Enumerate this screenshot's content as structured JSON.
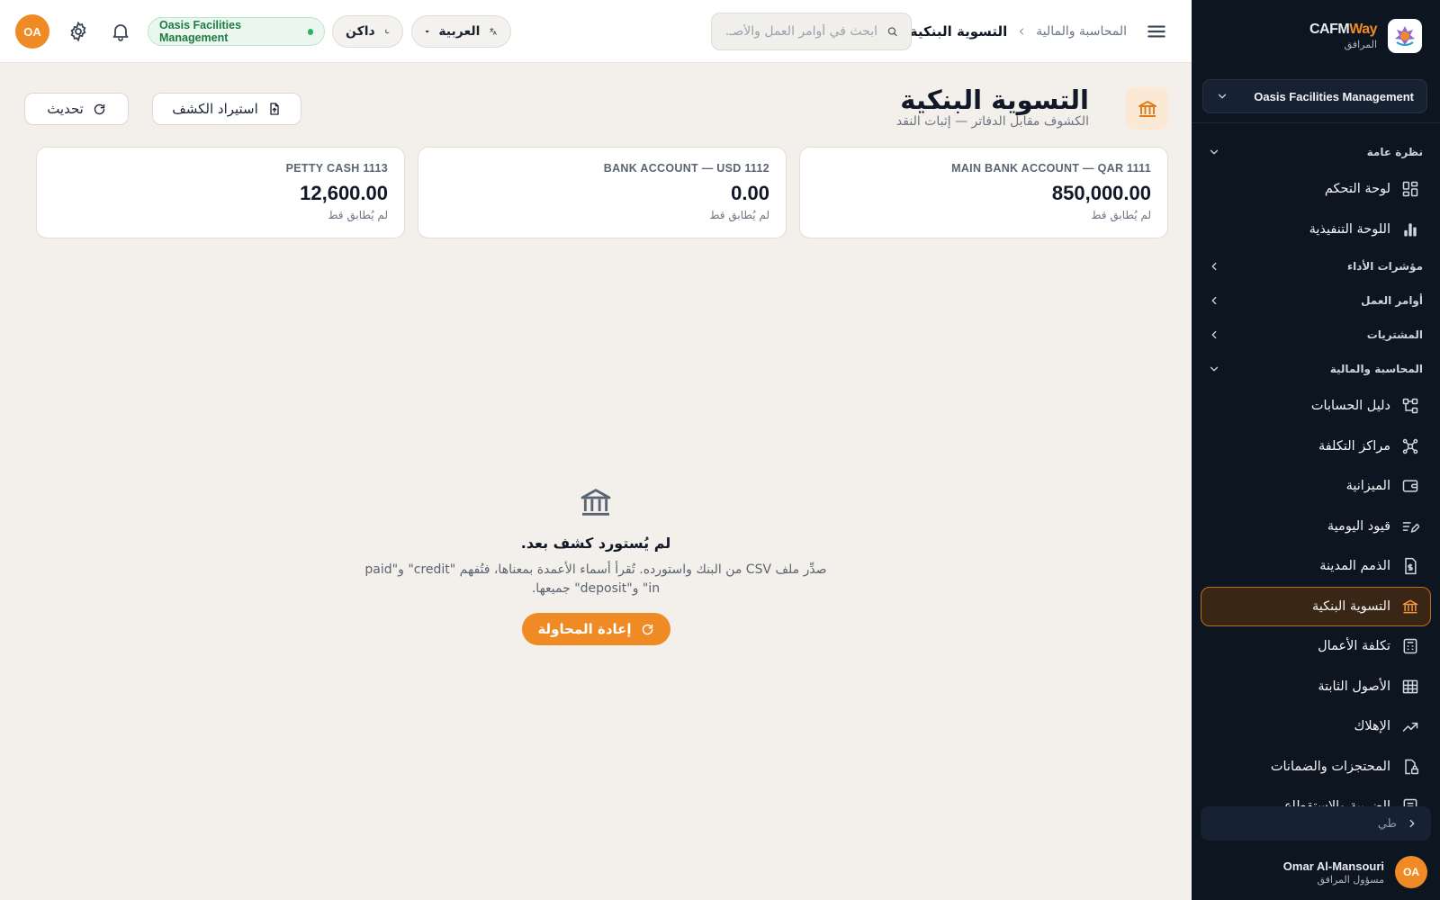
{
  "brand": {
    "name_main": "CAFM",
    "name_accent": "Way",
    "subtitle": "المرافق"
  },
  "sidebar": {
    "org_select": "Oasis Facilities Management",
    "sections": [
      {
        "label": "نظرة عامة",
        "expanded": true,
        "items": [
          {
            "label": "لوحة التحكم",
            "icon": "dashboard-grid-icon"
          },
          {
            "label": "اللوحة التنفيذية",
            "icon": "bar-chart-icon"
          }
        ]
      },
      {
        "label": "مؤشرات الأداء",
        "expanded": false,
        "items": []
      },
      {
        "label": "أوامر العمل",
        "expanded": false,
        "items": []
      },
      {
        "label": "المشتريات",
        "expanded": false,
        "items": []
      },
      {
        "label": "المحاسبة والمالية",
        "expanded": true,
        "items": [
          {
            "label": "دليل الحسابات",
            "icon": "hierarchy-icon"
          },
          {
            "label": "مراكز التكلفة",
            "icon": "network-icon"
          },
          {
            "label": "الميزانية",
            "icon": "wallet-icon"
          },
          {
            "label": "قيود اليومية",
            "icon": "journal-pen-icon"
          },
          {
            "label": "الذمم المدينة",
            "icon": "receivable-file-icon"
          },
          {
            "label": "التسوية البنكية",
            "icon": "bank-icon",
            "active": true
          },
          {
            "label": "تكلفة الأعمال",
            "icon": "calculator-icon"
          },
          {
            "label": "الأصول الثابتة",
            "icon": "building-icon"
          },
          {
            "label": "الإهلاك",
            "icon": "trend-down-icon"
          },
          {
            "label": "المحتجزات والضمانات",
            "icon": "lock-file-icon"
          },
          {
            "label": "الضريبة والاستقطاع",
            "icon": "tax-icon"
          }
        ]
      }
    ],
    "collapse_label": "طي",
    "user": {
      "initials": "OA",
      "name": "Omar Al-Mansouri",
      "role": "مسؤول المرافق"
    }
  },
  "topbar": {
    "breadcrumb": {
      "parent": "المحاسبة والمالية",
      "current": "التسوية البنكية"
    },
    "search": {
      "placeholder": "ابحث في أوامر العمل والأصـ..."
    },
    "language": "العربية",
    "theme": "داكن",
    "org_badge": "Oasis Facilities Management",
    "avatar_initials": "OA"
  },
  "page": {
    "title": "التسوية البنكية",
    "subtitle": "الكشوف مقابل الدفاتر — إثبات النقد",
    "import_label": "استيراد الكشف",
    "refresh_label": "تحديث"
  },
  "accounts": [
    {
      "name": "MAIN BANK ACCOUNT — QAR 1111",
      "amount": "850,000.00",
      "status": "لم يُطابق قط"
    },
    {
      "name": "BANK ACCOUNT — USD 1112",
      "amount": "0.00",
      "status": "لم يُطابق قط"
    },
    {
      "name": "PETTY CASH 1113",
      "amount": "12,600.00",
      "status": "لم يُطابق قط"
    }
  ],
  "empty_state": {
    "title": "لم يُستورد كشف بعد.",
    "description": "صدِّر ملف CSV من البنك واستورده. تُقرأ أسماء الأعمدة بمعناها، فتُفهم \"credit\" و\"paid in\" و\"deposit\" جميعها.",
    "retry_label": "إعادة المحاولة"
  },
  "colors": {
    "accent": "#f08a24",
    "sidebar_bg": "#0d1521",
    "page_bg": "#f3efea",
    "badge_green": "#2bb35f"
  }
}
